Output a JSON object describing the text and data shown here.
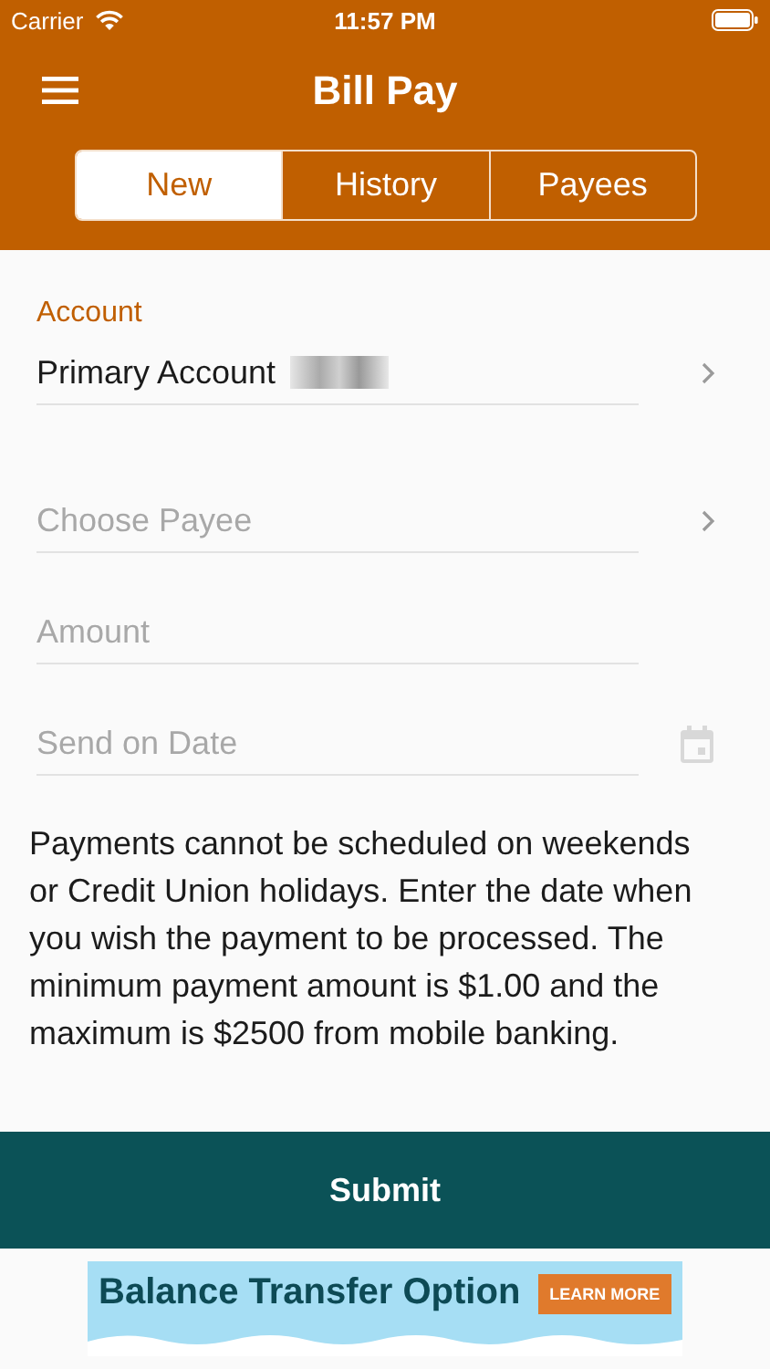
{
  "status_bar": {
    "carrier": "Carrier",
    "time": "11:57 PM"
  },
  "header": {
    "title": "Bill Pay"
  },
  "tabs": [
    {
      "label": "New",
      "selected": true
    },
    {
      "label": "History",
      "selected": false
    },
    {
      "label": "Payees",
      "selected": false
    }
  ],
  "fields": [
    {
      "kind": "select",
      "label": "Account",
      "value": "Primary Account",
      "masked": true
    },
    {
      "kind": "select",
      "placeholder": "Choose Payee"
    },
    {
      "kind": "text",
      "placeholder": "Amount"
    },
    {
      "kind": "date",
      "placeholder": "Send on Date"
    }
  ],
  "note": "Payments cannot be scheduled on weekends or Credit Union holidays. Enter the date when you wish the payment to be processed. The minimum payment amount is $1.00 and the maximum is $2500 from mobile banking.",
  "submit": "Submit",
  "banner": {
    "headline": "Balance Transfer Option",
    "button": "LEARN MORE"
  }
}
